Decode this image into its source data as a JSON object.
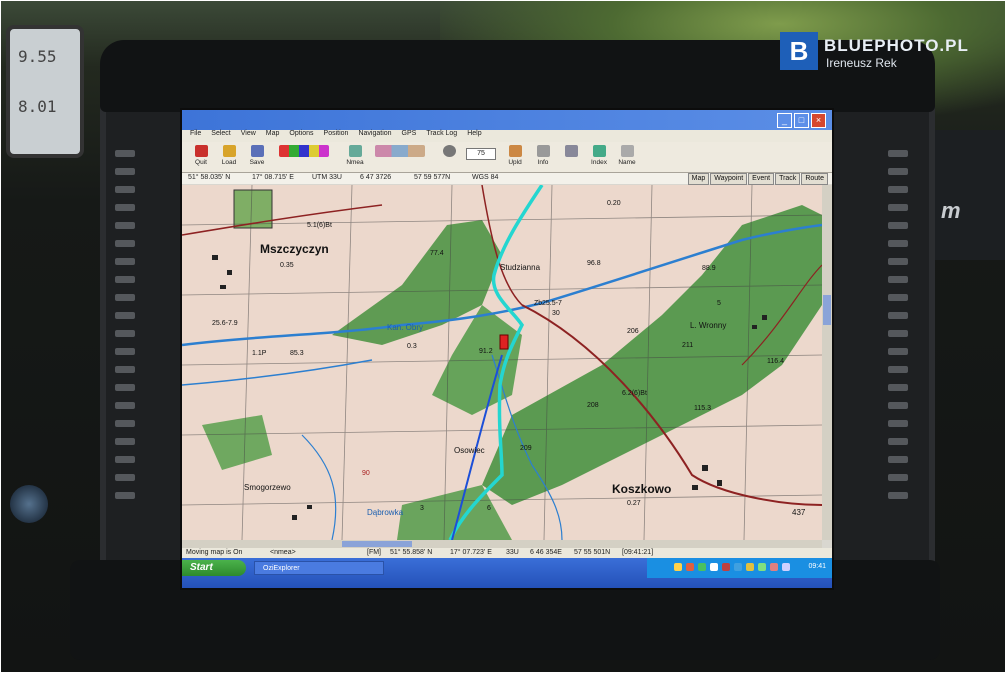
{
  "watermark": {
    "logo_letter": "B",
    "brand": "BLUEPHOTO.PL",
    "author": "Ireneusz Rek"
  },
  "left_device": {
    "line1": "9.55",
    "line2": "8.01"
  },
  "right_object": {
    "text": "m"
  },
  "app": {
    "title": "",
    "menu": [
      "File",
      "Select",
      "View",
      "Map",
      "Options",
      "Position",
      "Navigation",
      "GPS",
      "Track Log",
      "Help"
    ],
    "toolbar": [
      {
        "label": "Quit",
        "icon": "quit-icon"
      },
      {
        "label": "Load",
        "icon": "load-icon"
      },
      {
        "label": "Save",
        "icon": "save-icon"
      },
      {
        "label": "Nmea",
        "icon": "nmea-icon"
      },
      {
        "label": "Upld",
        "icon": "upload-icon"
      },
      {
        "label": "Info",
        "icon": "info-icon"
      },
      {
        "label": "Index",
        "icon": "index-icon"
      },
      {
        "label": "Name",
        "icon": "name-icon"
      }
    ],
    "zoom_value": "75",
    "coords_line": {
      "lat": "51° 58.035' N",
      "lon": "17° 08.715' E",
      "utm": "UTM 33U",
      "east": "6 47 3726",
      "north": "57 59 577N",
      "datum": "WGS 84"
    },
    "tabs": [
      "Map",
      "Waypoint",
      "Event",
      "Track",
      "Route"
    ],
    "map_labels": {
      "town1": "Mszczyczyn",
      "town2": "Koszkowo",
      "town3": "Smogorzewo",
      "village1": "Studzianna",
      "village2": "Osowiec",
      "village3": "L. Wronny",
      "river": "Kan. Obry",
      "stream": "Dąbrowka",
      "road_num": "437",
      "nums": [
        "0.35",
        "0.20",
        "96.8",
        "88.9",
        "77.4",
        "91.2",
        "116.4",
        "115.3",
        "0.27",
        "209",
        "208",
        "206",
        "211",
        "25.5-7",
        "30",
        "5.1(6)Bt",
        "6.2(6)Bt",
        "25.6-7.9",
        "85.3",
        "0.3",
        "1.1P",
        "3",
        "6",
        "90",
        "5",
        "Zb"
      ]
    },
    "statusbar": {
      "left": "Moving map is On",
      "nmea": "<nmea>",
      "fm": "[FM]",
      "lat": "51° 55.858' N",
      "lon": "17° 07.723' E",
      "zone": "33U",
      "east": "6 46 354E",
      "north": "57 55 501N",
      "time": "[09:41:21]"
    },
    "taskbar": {
      "start": "Start",
      "app": "OziExplorer",
      "clock": "09:41"
    }
  }
}
